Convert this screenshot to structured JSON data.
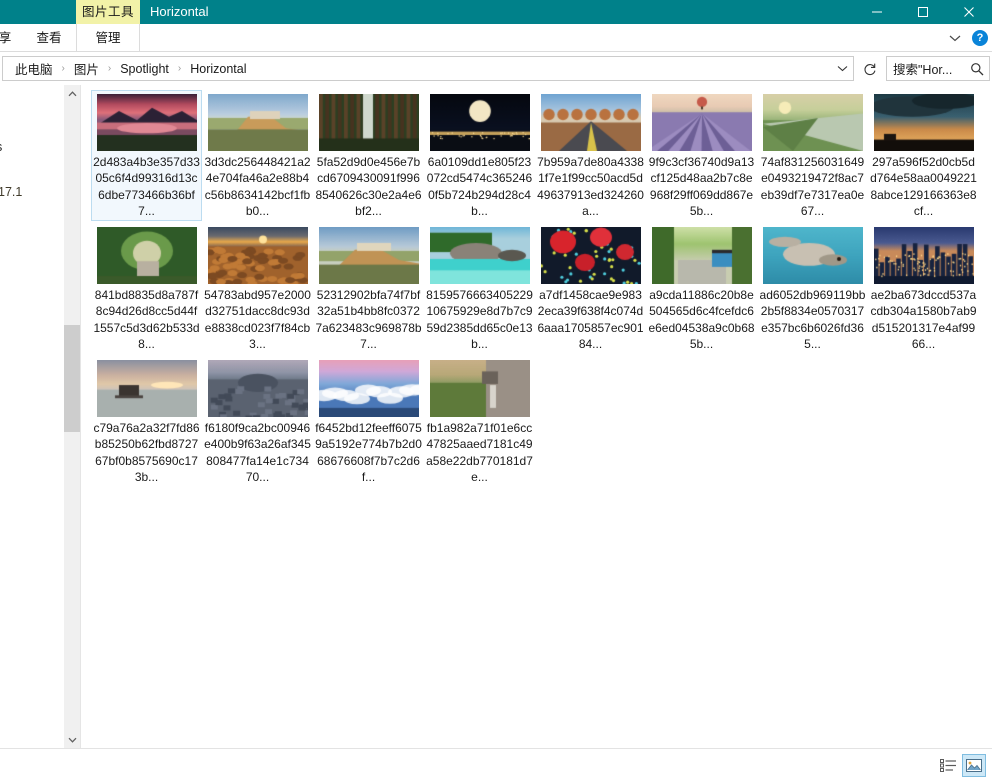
{
  "window": {
    "title": "Horizontal",
    "context_tab_label": "图片工具",
    "minimize_icon": "minimize-icon",
    "maximize_icon": "maximize-icon",
    "close_icon": "close-icon"
  },
  "ribbon": {
    "tabs": [
      {
        "label": "享",
        "name": "tab-share"
      },
      {
        "label": "查看",
        "name": "tab-view"
      },
      {
        "label": "管理",
        "name": "tab-manage"
      }
    ],
    "collapse_icon": "chevron-down-icon",
    "help_label": "?"
  },
  "address": {
    "crumbs": [
      "此电脑",
      "图片",
      "Spotlight",
      "Horizontal"
    ],
    "separator": "›",
    "dropdown_icon": "chevron-down-icon",
    "refresh_icon": "refresh-icon"
  },
  "search": {
    "value": "搜索\"Hor...",
    "placeholder": "搜索\"Horizontal\"",
    "icon": "search-icon"
  },
  "navpane": {
    "fragments": [
      "s",
      "17.1"
    ],
    "scrollbar": {
      "up_icon": "chevron-up-icon",
      "down_icon": "chevron-down-icon"
    }
  },
  "files": [
    {
      "name": "2d483a4b3e357d3305c6f4d99316d13c6dbe773466b36bf7...",
      "selected": true,
      "scene": "mountain-lake-sunset"
    },
    {
      "name": "3d3dc256448421a24e704fa46a2e88b4c56b8634142bcf1fbb0...",
      "selected": false,
      "scene": "cliff-town"
    },
    {
      "name": "5fa52d9d0e456e7bcd6709430091f9968540626c30e2a4e6bf2...",
      "selected": false,
      "scene": "forest-waterfall"
    },
    {
      "name": "6a0109dd1e805f23072cd5474c3652460f5b724b294d28c4b...",
      "selected": false,
      "scene": "moon-night"
    },
    {
      "name": "7b959a7de80a43381f7e1f99cc50acd5d49637913ed324260a...",
      "selected": false,
      "scene": "desert-road"
    },
    {
      "name": "9f9c3cf36740d9a13cf125d48aa2b7c8e968f29ff069dd867e5b...",
      "selected": false,
      "scene": "lavender-balloon"
    },
    {
      "name": "74af831256031649e0493219472f8ac7eb39df7e7317ea0e67...",
      "selected": false,
      "scene": "misty-meadow"
    },
    {
      "name": "297a596f52d0cb5dd764e58aa00492218abce129166363e8cf...",
      "selected": false,
      "scene": "storm-dusk"
    },
    {
      "name": "841bd8835d8a787f8c94d26d8cc5d44f1557c5d3d62b533d8...",
      "selected": false,
      "scene": "green-tunnel-path"
    },
    {
      "name": "54783abd957e2000d32751dacc8dc93de8838cd023f7f84cb3...",
      "selected": false,
      "scene": "autumn-hills"
    },
    {
      "name": "52312902bfa74f7bf32a51b4bb8fc03727a623483c969878b7...",
      "selected": false,
      "scene": "cliff-town-2"
    },
    {
      "name": "815957666340522910675929e8d7b7c959d2385dd65c0e13b...",
      "selected": false,
      "scene": "tropical-beach"
    },
    {
      "name": "a7df1458cae9e9832eca39f638f4c074d6aaa1705857ec90184...",
      "selected": false,
      "scene": "red-lanterns"
    },
    {
      "name": "a9cda11886c20b8e504565d6c4fcefdc6e6ed04538a9c0b685b...",
      "selected": false,
      "scene": "forest-road-truck"
    },
    {
      "name": "ad6052db969119bb2b5f8834e0570317e357bc6b6026fd365...",
      "selected": false,
      "scene": "seal-underwater"
    },
    {
      "name": "ae2ba673dccd537acdb304a1580b7ab9d515201317e4af9966...",
      "selected": false,
      "scene": "city-skyline-night"
    },
    {
      "name": "c79a76a2a32f7fd86b85250b62fbd872767bf0b8575690c173b...",
      "selected": false,
      "scene": "pier-sunset"
    },
    {
      "name": "f6180f9ca2bc00946e400b9f63a26af345808477fa14e1c73470...",
      "selected": false,
      "scene": "basalt-rocks"
    },
    {
      "name": "f6452bd12feeff60759a5192e774b7b2d068676608f7b7c2d6f...",
      "selected": false,
      "scene": "cloud-sunset"
    },
    {
      "name": "fb1a982a71f01e6cc47825aaed7181c49a58e22db770181d7e...",
      "selected": false,
      "scene": "cliff-overlook"
    }
  ],
  "statusbar": {
    "view_details_icon": "details-view-icon",
    "view_large_icons_icon": "large-icons-view-icon",
    "active_view": "large-icons"
  },
  "colors": {
    "titlebar": "#00818a",
    "context_tab": "#f2f2a8",
    "selection": "#f2f8fd",
    "selection_border": "#bcdcf0",
    "help_blue": "#0a84d8"
  }
}
